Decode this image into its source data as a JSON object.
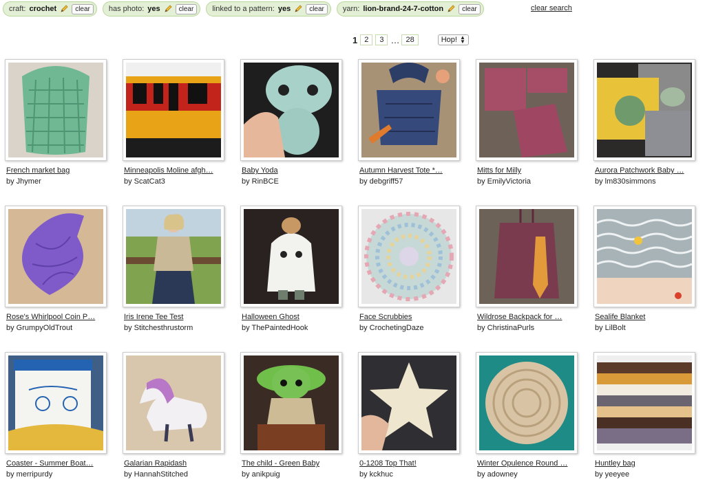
{
  "filters": [
    {
      "key": "craft:",
      "value": "crochet",
      "clear": "clear"
    },
    {
      "key": "has photo:",
      "value": "yes",
      "clear": "clear"
    },
    {
      "key": "linked to a pattern:",
      "value": "yes",
      "clear": "clear"
    },
    {
      "key": "yarn:",
      "value": "lion-brand-24-7-cotton",
      "clear": "clear"
    }
  ],
  "clear_search": "clear search",
  "pagination": {
    "current": "1",
    "pages": [
      "2",
      "3"
    ],
    "ellipsis": "…",
    "last": "28",
    "hop": "Hop!"
  },
  "colors": {
    "chip_bg": "#e3f0d6",
    "chip_border": "#b9d69a"
  },
  "projects": [
    {
      "title": "French market bag",
      "by": "by Jhymer",
      "photo": "mint crochet mesh bag"
    },
    {
      "title": "Minneapolis Moline afgh…",
      "by": "by ScatCat3",
      "photo": "red yellow black afghan"
    },
    {
      "title": "Baby Yoda",
      "by": "by RinBCE",
      "photo": "light blue amigurumi"
    },
    {
      "title": "Autumn Harvest Tote *…",
      "by": "by debgriff57",
      "photo": "navy tote with carrot"
    },
    {
      "title": "Mitts for Milly",
      "by": "by EmilyVictoria",
      "photo": "mauve fingerless mitts"
    },
    {
      "title": "Aurora Patchwork Baby …",
      "by": "by lm830simmons",
      "photo": "yellow grey squares"
    },
    {
      "title": "Rose's Whirlpool Coin P…",
      "by": "by GrumpyOldTrout",
      "photo": "purple coin purse"
    },
    {
      "title": "Iris Irene Tee Test",
      "by": "by Stitchesthrustorm",
      "photo": "woman in beige tee"
    },
    {
      "title": "Halloween Ghost",
      "by": "by ThePaintedHook",
      "photo": "white ghost amigurumi"
    },
    {
      "title": "Face Scrubbies",
      "by": "by CrochetingDaze",
      "photo": "pastel round scrubby"
    },
    {
      "title": "Wildrose Backpack for …",
      "by": "by ChristinaPurls",
      "photo": "plum backpack"
    },
    {
      "title": "Sealife Blanket",
      "by": "by LilBolt",
      "photo": "grey wave blanket"
    },
    {
      "title": "Coaster - Summer Boat…",
      "by": "by merripurdy",
      "photo": "mug on yellow coaster"
    },
    {
      "title": "Galarian Rapidash",
      "by": "by HannahStitched",
      "photo": "white unicorn plush"
    },
    {
      "title": "The child - Green Baby",
      "by": "by anikpuig",
      "photo": "green baby amigurumi"
    },
    {
      "title": "0-1208 Top That!",
      "by": "by kckhuc",
      "photo": "cream star cushion"
    },
    {
      "title": "Winter Opulence Round …",
      "by": "by adowney",
      "photo": "beige doily on teal"
    },
    {
      "title": "Huntley bag",
      "by": "by yeeyee",
      "photo": "striped brown orange bag"
    }
  ]
}
